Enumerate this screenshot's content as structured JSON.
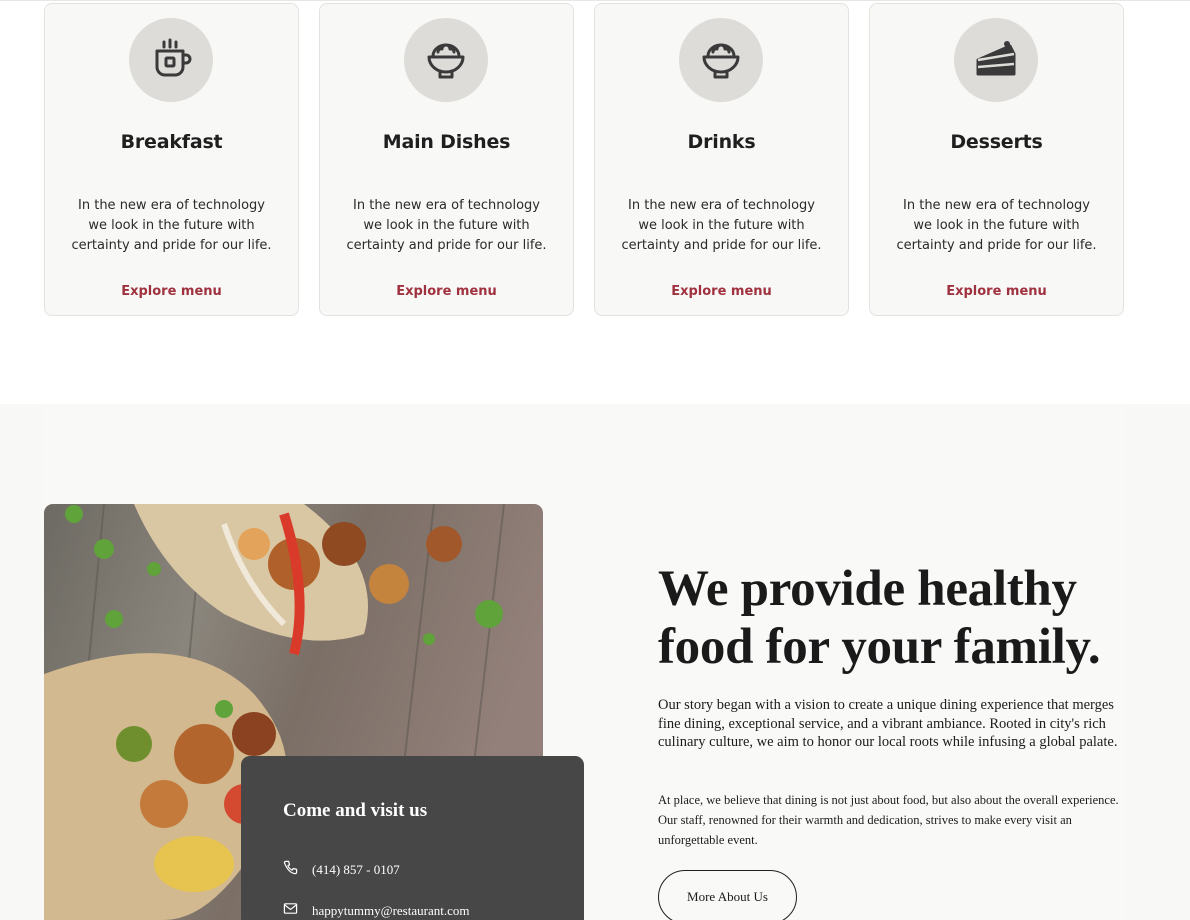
{
  "menu_cards": [
    {
      "title": "Breakfast",
      "icon": "coffee-cup-icon",
      "description": "In the new era of technology we look in the future with certainty and pride for our life.",
      "link": "Explore menu"
    },
    {
      "title": "Main Dishes",
      "icon": "bowl-icon",
      "description": "In the new era of technology we look in the future with certainty and pride for our life.",
      "link": "Explore menu"
    },
    {
      "title": "Drinks",
      "icon": "bowl-icon",
      "description": "In the new era of technology we look in the future with certainty and pride for our life.",
      "link": "Explore menu"
    },
    {
      "title": "Desserts",
      "icon": "cake-slice-icon",
      "description": "In the new era of technology we look in the future with certainty and pride for our life.",
      "link": "Explore menu"
    }
  ],
  "about": {
    "headline": "We provide healthy food for your family.",
    "story_1": "Our story began with a vision to create a unique dining experience that merges fine dining, exceptional service, and a vibrant ambiance. Rooted in city's rich culinary culture, we aim to honor our local roots while infusing a global palate.",
    "story_2": "At place, we believe that dining is not just about food, but also about the overall experience. Our staff, renowned for their warmth and dedication, strives to make every visit an unforgettable event.",
    "button_label": "More About Us"
  },
  "visit": {
    "title": "Come and visit us",
    "phone": "(414) 857 - 0107",
    "email": "happytummy@restaurant.com"
  },
  "colors": {
    "accent": "#a0323f",
    "card_bg": "#f8f8f6",
    "icon_circle": "#dddcd8",
    "visit_card_bg": "#474747"
  }
}
